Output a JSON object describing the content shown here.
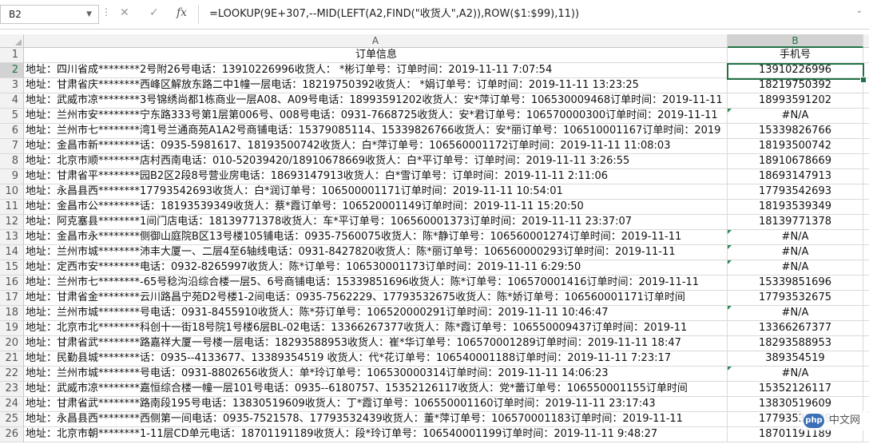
{
  "formula_bar": {
    "name_box": "B2",
    "cancel_icon": "✕",
    "enter_icon": "✓",
    "fx_icon": "fx",
    "formula": "=LOOKUP(9E+307,--MID(LEFT(A2,FIND(\"收货人\",A2)),ROW($1:$99),11))"
  },
  "columns": [
    {
      "letter": "A"
    },
    {
      "letter": "B"
    }
  ],
  "rows": [
    {
      "n": "1",
      "a": "订单信息",
      "b": "手机号"
    },
    {
      "n": "2",
      "a": "地址：四川省成********2号附26号电话：13910226996收货人： *彬订单号：订单时间：2019-11-11 7:07:54",
      "b": "13910226996"
    },
    {
      "n": "3",
      "a": "地址：甘肃省庆********西峰区解放东路二中1幢一层电话：18219750392收货人： *娟订单号：订单时间：2019-11-11 13:23:25",
      "b": "18219750392"
    },
    {
      "n": "4",
      "a": "地址：武威市凉********3号锦绣尚都1栋商业一层A08、A09号电话：18993591202收货人：安*萍订单号：106530009468订单时间：2019-11-11",
      "b": "18993591202"
    },
    {
      "n": "5",
      "a": "地址：兰州市安********宁东路333号第1层第006号、008号电话：0931-7668725收货人：安*君订单号：106570000300订单时间：2019-11-11",
      "b": "#N/A"
    },
    {
      "n": "6",
      "a": "地址：兰州市七********湾1号兰通商苑A1A2号商铺电话：15379085114、15339826766收货人：安*丽订单号：106510001167订单时间：2019",
      "b": "15339826766"
    },
    {
      "n": "7",
      "a": "地址：金昌市新********话：0935-5981617、18193500742收货人：白*萍订单号：106560001172订单时间：2019-11-11 11:08:03",
      "b": "18193500742"
    },
    {
      "n": "8",
      "a": "地址：北京市顺********店村西南电话：010-52039420/18910678669收货人：白*平订单号：订单时间：2019-11-11 3:26:55",
      "b": "18910678669"
    },
    {
      "n": "9",
      "a": "地址：甘肃省平********园B2区2段8号营业房电话：18693147913收货人：白*雪订单号：订单时间：2019-11-11 2:11:06",
      "b": "18693147913"
    },
    {
      "n": "10",
      "a": "地址：永昌县西********17793542693收货人：白*润订单号：106500001171订单时间：2019-11-11 10:54:01",
      "b": "17793542693"
    },
    {
      "n": "11",
      "a": "地址：金昌市公********话：18193539349收货人：蔡*霞订单号：106520001149订单时间：2019-11-11 15:20:50",
      "b": "18193539349"
    },
    {
      "n": "12",
      "a": "地址：阿克塞县********1间门店电话：18139771378收货人：车*平订单号：106560001373订单时间：2019-11-11 23:37:07",
      "b": "18139771378"
    },
    {
      "n": "13",
      "a": "地址：金昌市永********侧御山庭院B区13号楼105铺电话：0935-7560075收货人：陈*静订单号：106560001274订单时间：2019-11-11",
      "b": "#N/A"
    },
    {
      "n": "14",
      "a": "地址：兰州市城********沛丰大厦一、二层4至6轴线电话：0931-8427820收货人：陈*丽订单号：106560000293订单时间：2019-11-11",
      "b": "#N/A"
    },
    {
      "n": "15",
      "a": "地址：定西市安********电话：0932-8265997收货人：陈*订单号：106530001173订单时间：2019-11-11 6:29:50",
      "b": "#N/A"
    },
    {
      "n": "16",
      "a": "地址：兰州市七********-65号稔沟沿综合楼一层5、6号商铺电话：15339851696收货人：陈*订单号：106570001416订单时间：2019-11-11",
      "b": "15339851696"
    },
    {
      "n": "17",
      "a": "地址：甘肃省金********云川路昌宁苑D2号楼1-2间电话：0935-7562229、17793532675收货人：陈*娇订单号：106560001171订单时间",
      "b": "17793532675"
    },
    {
      "n": "18",
      "a": "地址：兰州市城********号电话：0931-8455910收货人：陈*芬订单号：106520000291订单时间：2019-11-11 10:46:47",
      "b": "#N/A"
    },
    {
      "n": "19",
      "a": "地址：北京市北********科创十一街18号院1号楼6层BL-02电话：13366267377收货人：陈*霞订单号：106550009437订单时间：2019-11",
      "b": "13366267377"
    },
    {
      "n": "20",
      "a": "地址：甘肃省武********路嘉祥大厦一号楼一层电话：18293588953收货人：崔*华订单号：106570001289订单时间：2019-11-11 18:47",
      "b": "18293588953"
    },
    {
      "n": "21",
      "a": "地址：民勤县城********话：0935--4133677、13389354519 收货人：代*花订单号：106540001188订单时间：2019-11-11 7:23:17",
      "b": "389354519"
    },
    {
      "n": "22",
      "a": "地址：兰州市城********号电话：0931-8802656收货人：单*玲订单号：106530000314订单时间：2019-11-11 14:06:23",
      "b": "#N/A"
    },
    {
      "n": "23",
      "a": "地址：武威市凉********嘉恒综合楼一幢一层101号电话：0935--6180757、15352126117收货人：党*蕾订单号：106550001155订单时间",
      "b": "15352126117"
    },
    {
      "n": "24",
      "a": "地址：甘肃省武********路南段195号电话：13830519609收货人：丁*霞订单号：106550001160订单时间：2019-11-11 23:17:43",
      "b": "13830519609"
    },
    {
      "n": "25",
      "a": "地址：永昌县西********西侧第一间电话：0935-7521578、17793532439收货人：董*萍订单号：106570001183订单时间：2019-11-11",
      "b": "17793532439"
    },
    {
      "n": "26",
      "a": "地址：北京市朝********1-11层CD单元电话：18701191189收货人：段*玲订单号：106540001199订单时间：2019-11-11 9:48:27",
      "b": "18701191189"
    }
  ],
  "error_rows": [
    "5",
    "13",
    "14",
    "15",
    "18",
    "22"
  ],
  "watermark": {
    "logo": "php",
    "text": "中文网"
  },
  "colors": {
    "accent": "#217346",
    "header_bg": "#f2f2f2",
    "grid": "#d9d9d9"
  }
}
